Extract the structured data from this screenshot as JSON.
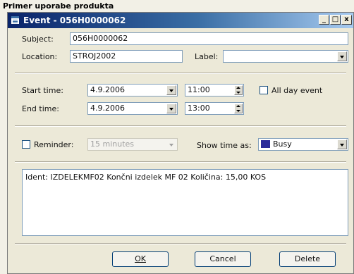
{
  "caption": "Primer uporabe produkta",
  "window": {
    "title": "Event - 056H0000062",
    "minimize_label": "_",
    "maximize_label": "□",
    "close_label": "x"
  },
  "subject": {
    "label": "Subject:",
    "value": "056H0000062"
  },
  "location": {
    "label": "Location:",
    "value": "STROJ2002"
  },
  "label_field": {
    "label": "Label:",
    "value": ""
  },
  "start": {
    "label": "Start time:",
    "date": "4.9.2006",
    "time": "11:00"
  },
  "end": {
    "label": "End time:",
    "date": "4.9.2006",
    "time": "13:00"
  },
  "all_day": {
    "label": "All day event",
    "checked": false
  },
  "reminder": {
    "label": "Reminder:",
    "checked": false,
    "value": "15 minutes"
  },
  "show_time_as": {
    "label": "Show time as:",
    "value": "Busy",
    "color": "#2a2a9a"
  },
  "memo": "Ident: IZDELEKMF02 Končni izdelek MF 02 Količina: 15,00 KOS",
  "buttons": {
    "ok": "OK",
    "cancel": "Cancel",
    "delete": "Delete"
  },
  "icons": [
    "window-app-icon",
    "minimize-icon",
    "maximize-icon",
    "close-icon",
    "dropdown-arrow-icon",
    "spin-arrows-icon"
  ]
}
